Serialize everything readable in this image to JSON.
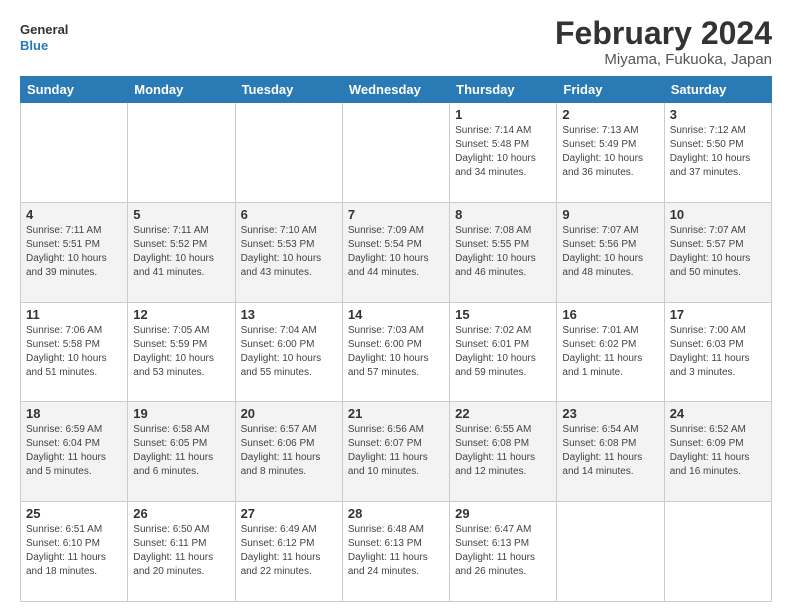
{
  "logo": {
    "line1": "General",
    "line2": "Blue"
  },
  "title": "February 2024",
  "subtitle": "Miyama, Fukuoka, Japan",
  "weekdays": [
    "Sunday",
    "Monday",
    "Tuesday",
    "Wednesday",
    "Thursday",
    "Friday",
    "Saturday"
  ],
  "weeks": [
    [
      {
        "day": "",
        "info": ""
      },
      {
        "day": "",
        "info": ""
      },
      {
        "day": "",
        "info": ""
      },
      {
        "day": "",
        "info": ""
      },
      {
        "day": "1",
        "info": "Sunrise: 7:14 AM\nSunset: 5:48 PM\nDaylight: 10 hours\nand 34 minutes."
      },
      {
        "day": "2",
        "info": "Sunrise: 7:13 AM\nSunset: 5:49 PM\nDaylight: 10 hours\nand 36 minutes."
      },
      {
        "day": "3",
        "info": "Sunrise: 7:12 AM\nSunset: 5:50 PM\nDaylight: 10 hours\nand 37 minutes."
      }
    ],
    [
      {
        "day": "4",
        "info": "Sunrise: 7:11 AM\nSunset: 5:51 PM\nDaylight: 10 hours\nand 39 minutes."
      },
      {
        "day": "5",
        "info": "Sunrise: 7:11 AM\nSunset: 5:52 PM\nDaylight: 10 hours\nand 41 minutes."
      },
      {
        "day": "6",
        "info": "Sunrise: 7:10 AM\nSunset: 5:53 PM\nDaylight: 10 hours\nand 43 minutes."
      },
      {
        "day": "7",
        "info": "Sunrise: 7:09 AM\nSunset: 5:54 PM\nDaylight: 10 hours\nand 44 minutes."
      },
      {
        "day": "8",
        "info": "Sunrise: 7:08 AM\nSunset: 5:55 PM\nDaylight: 10 hours\nand 46 minutes."
      },
      {
        "day": "9",
        "info": "Sunrise: 7:07 AM\nSunset: 5:56 PM\nDaylight: 10 hours\nand 48 minutes."
      },
      {
        "day": "10",
        "info": "Sunrise: 7:07 AM\nSunset: 5:57 PM\nDaylight: 10 hours\nand 50 minutes."
      }
    ],
    [
      {
        "day": "11",
        "info": "Sunrise: 7:06 AM\nSunset: 5:58 PM\nDaylight: 10 hours\nand 51 minutes."
      },
      {
        "day": "12",
        "info": "Sunrise: 7:05 AM\nSunset: 5:59 PM\nDaylight: 10 hours\nand 53 minutes."
      },
      {
        "day": "13",
        "info": "Sunrise: 7:04 AM\nSunset: 6:00 PM\nDaylight: 10 hours\nand 55 minutes."
      },
      {
        "day": "14",
        "info": "Sunrise: 7:03 AM\nSunset: 6:00 PM\nDaylight: 10 hours\nand 57 minutes."
      },
      {
        "day": "15",
        "info": "Sunrise: 7:02 AM\nSunset: 6:01 PM\nDaylight: 10 hours\nand 59 minutes."
      },
      {
        "day": "16",
        "info": "Sunrise: 7:01 AM\nSunset: 6:02 PM\nDaylight: 11 hours\nand 1 minute."
      },
      {
        "day": "17",
        "info": "Sunrise: 7:00 AM\nSunset: 6:03 PM\nDaylight: 11 hours\nand 3 minutes."
      }
    ],
    [
      {
        "day": "18",
        "info": "Sunrise: 6:59 AM\nSunset: 6:04 PM\nDaylight: 11 hours\nand 5 minutes."
      },
      {
        "day": "19",
        "info": "Sunrise: 6:58 AM\nSunset: 6:05 PM\nDaylight: 11 hours\nand 6 minutes."
      },
      {
        "day": "20",
        "info": "Sunrise: 6:57 AM\nSunset: 6:06 PM\nDaylight: 11 hours\nand 8 minutes."
      },
      {
        "day": "21",
        "info": "Sunrise: 6:56 AM\nSunset: 6:07 PM\nDaylight: 11 hours\nand 10 minutes."
      },
      {
        "day": "22",
        "info": "Sunrise: 6:55 AM\nSunset: 6:08 PM\nDaylight: 11 hours\nand 12 minutes."
      },
      {
        "day": "23",
        "info": "Sunrise: 6:54 AM\nSunset: 6:08 PM\nDaylight: 11 hours\nand 14 minutes."
      },
      {
        "day": "24",
        "info": "Sunrise: 6:52 AM\nSunset: 6:09 PM\nDaylight: 11 hours\nand 16 minutes."
      }
    ],
    [
      {
        "day": "25",
        "info": "Sunrise: 6:51 AM\nSunset: 6:10 PM\nDaylight: 11 hours\nand 18 minutes."
      },
      {
        "day": "26",
        "info": "Sunrise: 6:50 AM\nSunset: 6:11 PM\nDaylight: 11 hours\nand 20 minutes."
      },
      {
        "day": "27",
        "info": "Sunrise: 6:49 AM\nSunset: 6:12 PM\nDaylight: 11 hours\nand 22 minutes."
      },
      {
        "day": "28",
        "info": "Sunrise: 6:48 AM\nSunset: 6:13 PM\nDaylight: 11 hours\nand 24 minutes."
      },
      {
        "day": "29",
        "info": "Sunrise: 6:47 AM\nSunset: 6:13 PM\nDaylight: 11 hours\nand 26 minutes."
      },
      {
        "day": "",
        "info": ""
      },
      {
        "day": "",
        "info": ""
      }
    ]
  ]
}
